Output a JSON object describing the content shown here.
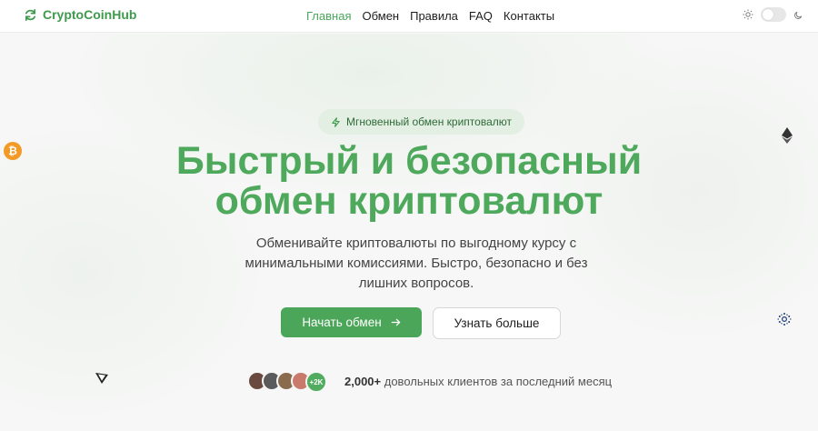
{
  "header": {
    "logo_text": "CryptoCoinHub",
    "nav": [
      {
        "label": "Главная",
        "active": true
      },
      {
        "label": "Обмен",
        "active": false
      },
      {
        "label": "Правила",
        "active": false
      },
      {
        "label": "FAQ",
        "active": false
      },
      {
        "label": "Контакты",
        "active": false
      }
    ],
    "theme_toggle": {
      "state": "light",
      "icons": [
        "sun-icon",
        "moon-icon"
      ]
    }
  },
  "hero": {
    "badge": "Мгновенный обмен криптовалют",
    "headline_line1": "Быстрый и безопасный",
    "headline_line2": "обмен криптовалют",
    "subtitle": "Обменивайте криптовалюты по выгодному курсу с минимальными комиссиями. Быстро, безопасно и без лишних вопросов.",
    "primary_button": "Начать обмен",
    "secondary_button": "Узнать больше",
    "avatars_more": "+2K",
    "clients_count": "2,000+",
    "clients_text": " довольных клиентов за последний месяц",
    "floating_icons": [
      "bitcoin-icon",
      "ethereum-icon",
      "cardano-icon",
      "tron-icon"
    ]
  },
  "colors": {
    "accent": "#4ba65a",
    "accent_dark": "#3e9a4c",
    "badge_bg": "#e4efe4",
    "bitcoin": "#f39a26"
  }
}
